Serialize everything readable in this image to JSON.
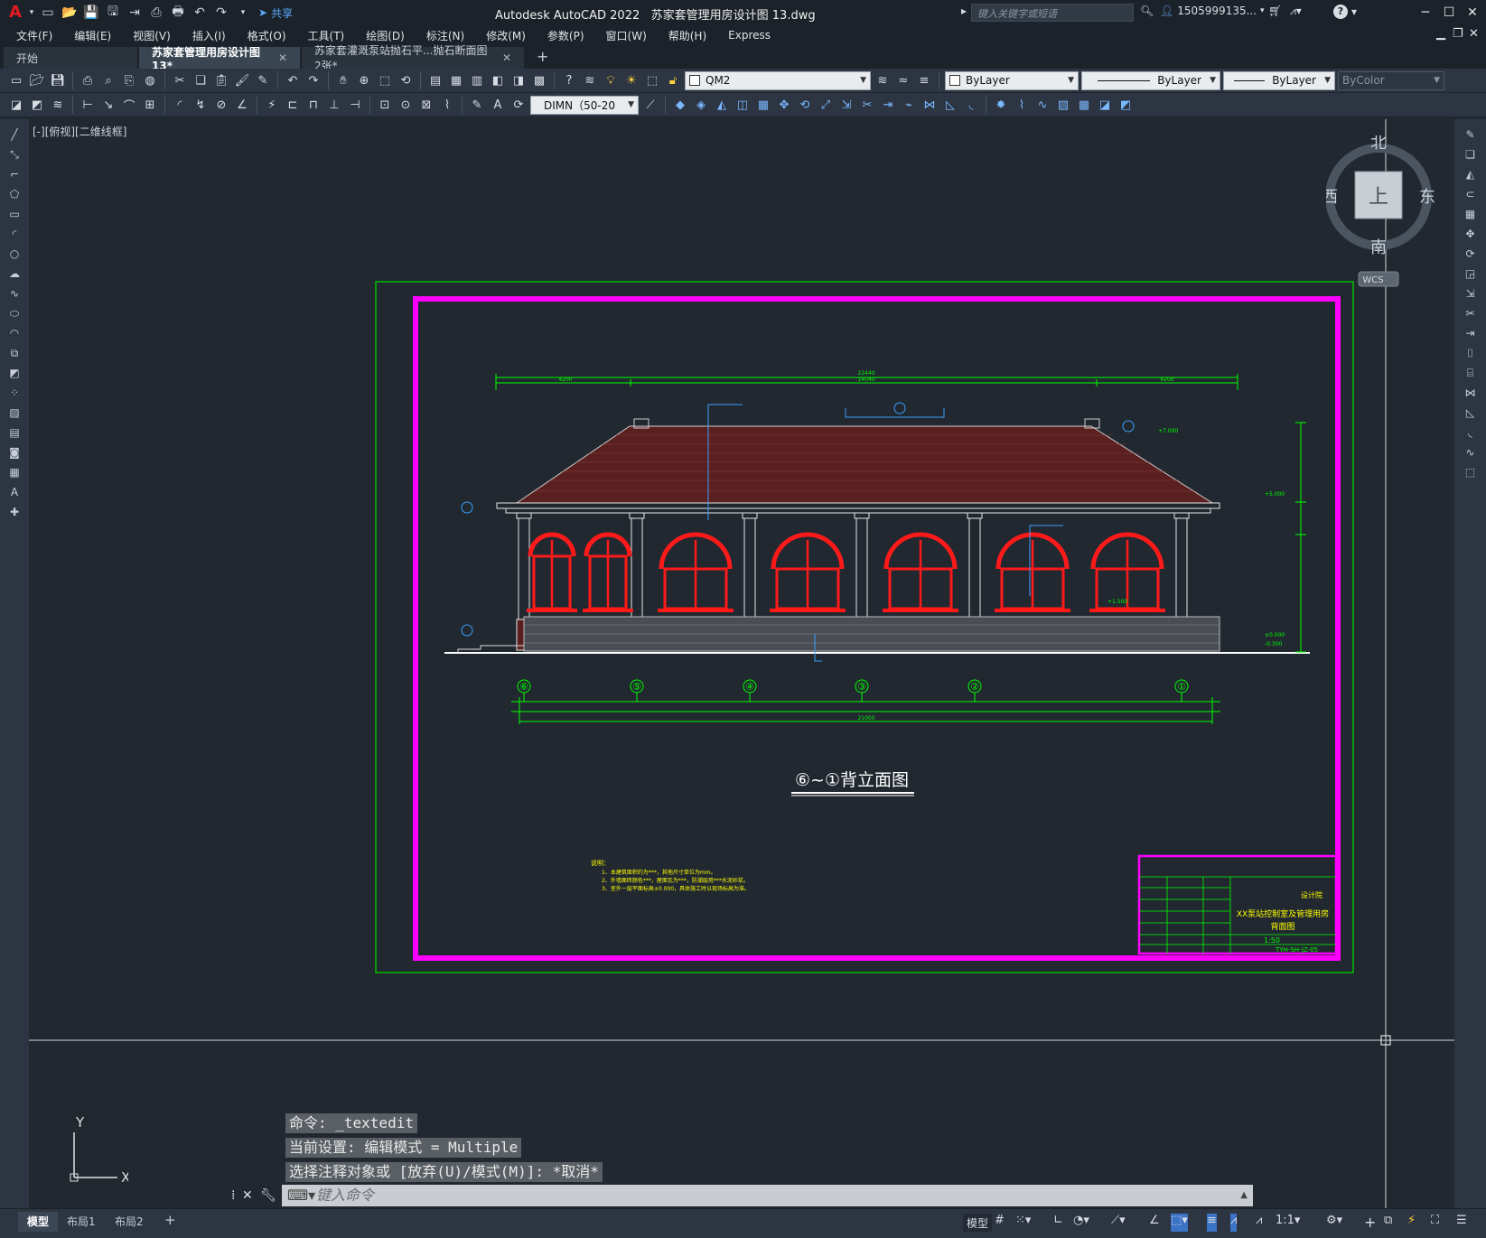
{
  "titlebar": {
    "app_title": "Autodesk AutoCAD 2022",
    "file_title": "苏家套管理用房设计图 13.dwg",
    "share_label": "共享",
    "search_placeholder": "键入关键字或短语",
    "user": "1505999135...",
    "help": "?"
  },
  "menu": [
    "文件(F)",
    "编辑(E)",
    "视图(V)",
    "插入(I)",
    "格式(O)",
    "工具(T)",
    "绘图(D)",
    "标注(N)",
    "修改(M)",
    "参数(P)",
    "窗口(W)",
    "帮助(H)",
    "Express"
  ],
  "tabs": [
    {
      "label": "开始"
    },
    {
      "label": "苏家套管理用房设计图 13*"
    },
    {
      "label": "苏家套灌溉泵站抛石平...抛石断面图 2张*"
    }
  ],
  "toolbar1": {
    "layer_name": "QM2",
    "color": "ByLayer",
    "linetype": "ByLayer",
    "lineweight": "ByLayer",
    "plotstyle": "ByColor"
  },
  "toolbar2": {
    "dimstyle": "DIMN（50-20"
  },
  "viewport_label": "[-][俯视][二维线框]",
  "viewcube": {
    "north": "北",
    "south": "南",
    "east": "东",
    "west": "西",
    "top": "上",
    "wcs": "WCS"
  },
  "drawing": {
    "title": "⑥~①背立面图",
    "axis_labels": [
      "⑥",
      "⑤",
      "④",
      "③",
      "②",
      "①"
    ],
    "overall_dim_top": "22440",
    "segment_dims_top": [
      "4200",
      "14040",
      "4200"
    ],
    "overall_dim_bottom": "21000",
    "notes_title": "说明：",
    "notes": [
      "1、本建筑面积约为***，其他尺寸单位为mm。",
      "2、外墙面砖颜色***，屋面瓦为***，防潮层用***水泥砂浆。",
      "3、室外一层平面标高±0.000，具体施工时以现场标高为准。"
    ],
    "titleblock": {
      "project": "XX泵站控制室及管理用房",
      "drawing_name": "背面图",
      "scale": "1:50",
      "number": "TYH-SH-JZ-05",
      "company": "设计院"
    },
    "elevations": [
      "+7.000",
      "+5.000",
      "+1.500",
      "±0.000",
      "-0.300"
    ],
    "colors": {
      "frame_outer": "#00c000",
      "frame_inner": "#ff00ff",
      "roof": "#7a2a2a",
      "window": "#ff1a1a",
      "dimension": "#00ff00",
      "leader": "#3aa0ff",
      "note": "#ffff00",
      "wall": "#e6e6e6"
    }
  },
  "command": {
    "history": [
      "命令: _textedit",
      "当前设置: 编辑模式 = Multiple",
      "选择注释对象或 [放弃(U)/模式(M)]: *取消*"
    ],
    "input_placeholder": "键入命令"
  },
  "ucs": {
    "x": "X",
    "y": "Y"
  },
  "layouts": [
    "模型",
    "布局1",
    "布局2"
  ],
  "status": {
    "model_label": "模型",
    "scale": "1:1"
  }
}
